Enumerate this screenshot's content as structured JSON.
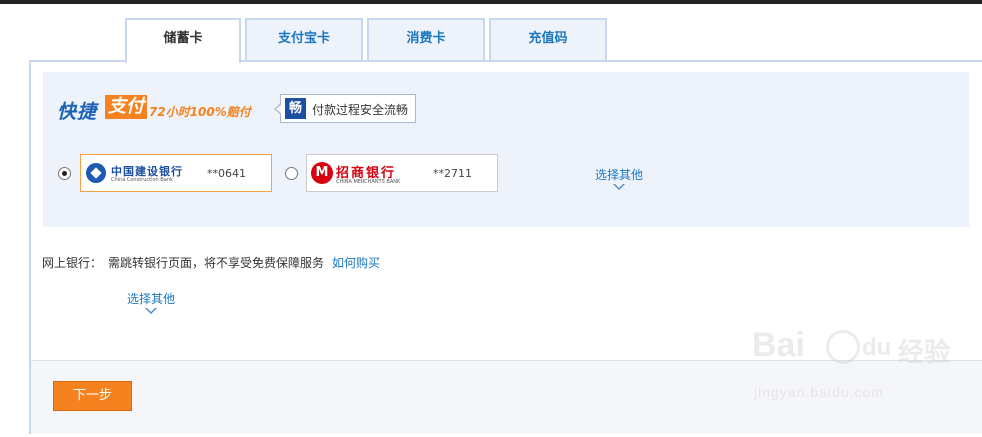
{
  "tabs": [
    {
      "label": "储蓄卡",
      "active": true
    },
    {
      "label": "支付宝卡",
      "active": false
    },
    {
      "label": "消费卡",
      "active": false
    },
    {
      "label": "充值码",
      "active": false
    }
  ],
  "quick_pay": {
    "brand_main": "快捷",
    "brand_highlight": "支付",
    "guarantee": "72小时100%赔付",
    "secure_icon_char": "畅",
    "secure_text": "付款过程安全流畅",
    "cards": [
      {
        "bank_name": "中国建设银行",
        "bank_name_en": "China Construction Bank",
        "card_tail": "**0641",
        "selected": true
      },
      {
        "bank_name": "招商银行",
        "bank_name_en": "CHINA MERCHANTS BANK",
        "logo_char": "M",
        "card_tail": "**2711",
        "selected": false
      }
    ],
    "select_other": "选择其他"
  },
  "net_bank": {
    "label": "网上银行：",
    "description": "需跳转银行页面，将不享受免费保障服务",
    "link": "如何购买",
    "select_other": "选择其他"
  },
  "footer": {
    "next_label": "下一步"
  },
  "watermark": {
    "brand": "Bai",
    "brand_suffix": "du",
    "jingyan": "经验",
    "url": "jingyan.baidu.com"
  },
  "colors": {
    "accent_orange": "#f5821f",
    "link_blue": "#1b77c0",
    "panel_border": "#c9d8ee"
  }
}
